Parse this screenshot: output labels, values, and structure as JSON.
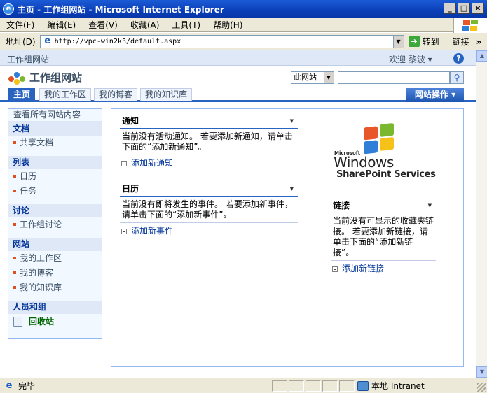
{
  "window": {
    "title": "主页 - 工作组网站 - Microsoft Internet Explorer",
    "minimize_label": "_",
    "maximize_label": "□",
    "close_label": "×"
  },
  "menubar": {
    "items": [
      "文件(F)",
      "编辑(E)",
      "查看(V)",
      "收藏(A)",
      "工具(T)",
      "帮助(H)"
    ]
  },
  "addressbar": {
    "label": "地址(D)",
    "url": "http://vpc-win2k3/default.aspx",
    "go_label": "转到",
    "links_label": "链接",
    "chevron": "»"
  },
  "sharepoint": {
    "breadcrumb": "工作组网站",
    "welcome": "欢迎 黎波 ▾",
    "help": "?",
    "site_title": "工作组网站",
    "scope_select": "此网站",
    "search_placeholder": "",
    "search_glyph": "⚲",
    "tabs": [
      "主页",
      "我的工作区",
      "我的博客",
      "我的知识库"
    ],
    "site_actions": "网站操作 ▾"
  },
  "quicklaunch": {
    "view_all": "查看所有网站内容",
    "sections": {
      "documents": {
        "heading": "文档",
        "items": [
          "共享文档"
        ]
      },
      "lists": {
        "heading": "列表",
        "items": [
          "日历",
          "任务"
        ]
      },
      "discussions": {
        "heading": "讨论",
        "items": [
          "工作组讨论"
        ]
      },
      "sites": {
        "heading": "网站",
        "items": [
          "我的工作区",
          "我的博客",
          "我的知识库"
        ]
      },
      "people": {
        "heading": "人员和组"
      }
    },
    "recycle_bin": "回收站"
  },
  "webparts": {
    "announcements": {
      "title": "通知",
      "body": "当前没有活动通知。 若要添加新通知，请单击下面的“添加新通知”。",
      "add_link": "添加新通知"
    },
    "calendar": {
      "title": "日历",
      "body": "当前没有即将发生的事件。 若要添加新事件，请单击下面的“添加新事件”。",
      "add_link": "添加新事件"
    },
    "links": {
      "title": "链接",
      "body": "当前没有可显示的收藏夹链接。 若要添加新链接，请单击下面的“添加新链接”。",
      "add_link": "添加新链接"
    },
    "menu_glyph": "▼"
  },
  "logo": {
    "microsoft": "Microsoft",
    "windows": "Windows",
    "product": "SharePoint Services"
  },
  "statusbar": {
    "text": "完毕",
    "zone": "本地 Intranet"
  },
  "colors": {
    "titlebar": "#0a3fb8",
    "accent": "#2963c2",
    "quicklaunch_bg": "#f2f8ff",
    "link": "#003399"
  }
}
